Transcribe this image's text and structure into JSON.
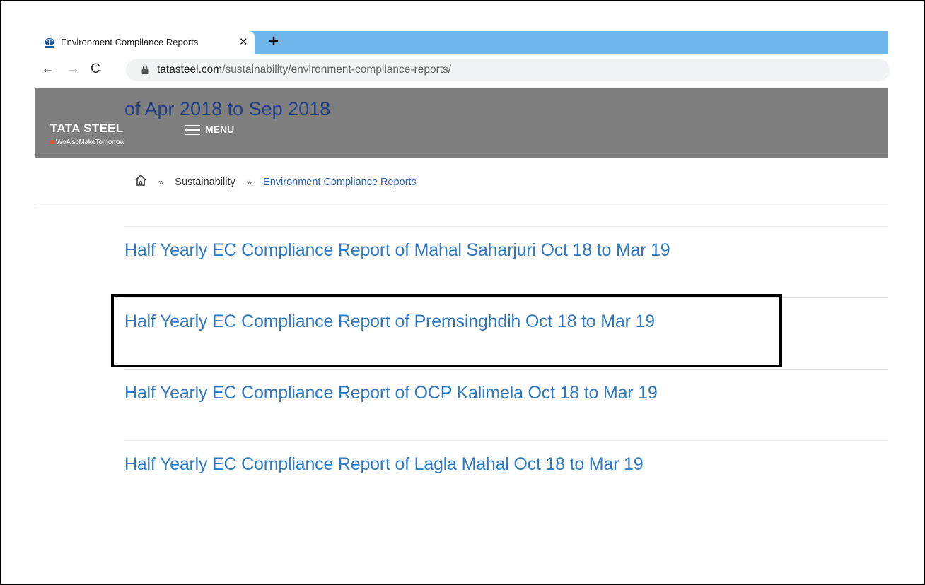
{
  "browser": {
    "tab_title": "Environment Compliance Reports",
    "close_glyph": "✕",
    "newtab_glyph": "+",
    "back_glyph": "←",
    "forward_glyph": "→",
    "reload_glyph": "C",
    "url_host": "tatasteel.com",
    "url_path": "/sustainability/environment-compliance-reports/"
  },
  "header": {
    "scrolled_heading_line2": "of Apr 2018 to Sep 2018",
    "logo": "TATA STEEL",
    "tagline": "WeAlsoMakeTomorrow",
    "menu_label": "MENU"
  },
  "breadcrumb": {
    "sep": "»",
    "items": [
      "Sustainability",
      "Environment Compliance Reports"
    ]
  },
  "reports": [
    "Half Yearly EC Compliance Report of Mahal Saharjuri Oct 18 to Mar 19",
    "Half Yearly EC Compliance Report of Premsinghdih Oct 18 to Mar 19",
    "Half Yearly EC Compliance Report of OCP Kalimela Oct 18 to Mar 19",
    "Half Yearly EC Compliance Report of Lagla Mahal Oct 18 to Mar 19"
  ],
  "colors": {
    "link": "#2e78c4",
    "header_bg": "#7f7f7f",
    "tabstrip": "#6fb6ea"
  }
}
